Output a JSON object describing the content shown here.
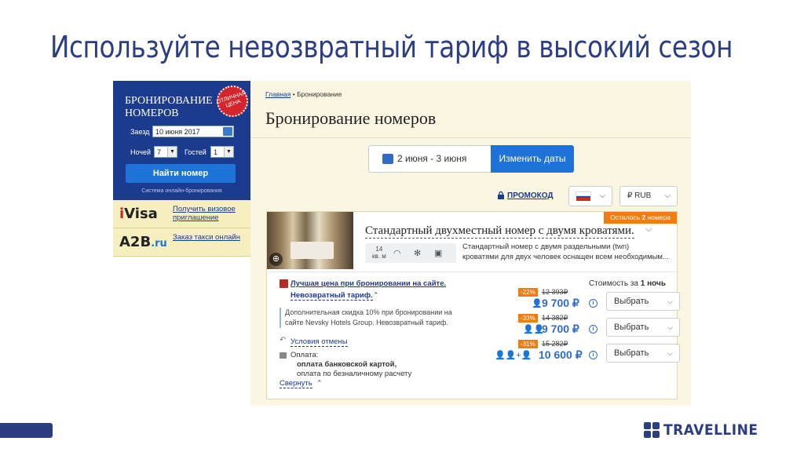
{
  "slide": {
    "title": "Используйте невозвратный тариф в высокий сезон",
    "brand": "TRAVELLINE"
  },
  "widget": {
    "title": "Бронирование номеров",
    "stamp": "ОТЛИЧНАЯ ЦЕНА",
    "checkin_label": "Заезд",
    "checkin_value": "10 июня 2017",
    "nights_label": "Ночей",
    "nights_value": "7",
    "guests_label": "Гостей",
    "guests_value": "1",
    "search_button": "Найти номер",
    "footer": "Система онлайн-бронирования"
  },
  "promos": [
    {
      "logo_a": "i",
      "logo_b": "Visa",
      "text": "Получить визовое приглашение"
    },
    {
      "logo_a": "A2B",
      "logo_b": ".ru",
      "text": "Заказ такси онлайн"
    }
  ],
  "panel": {
    "breadcrumb_home": "Главная",
    "breadcrumb_sep": "•",
    "breadcrumb_current": "Бронирование",
    "title": "Бронирование номеров",
    "dates": "2 июня - 3 июня",
    "change_dates": "Изменить даты",
    "promocode": "ПРОМОКОД",
    "currency": "₽ RUB",
    "flag_colors": [
      "#ffffff",
      "#1e4fb4",
      "#d52b1e"
    ]
  },
  "room": {
    "badge_prefix": "Осталось",
    "badge_count": "2",
    "badge_suffix": "номера",
    "title": "Стандартный двухместный номер с двумя кроватями.",
    "area": "14",
    "area_unit": "кв. м",
    "desc_line1": "Стандартный номер с двумя раздельными (twn)",
    "desc_line2": "кроватями для двух человек оснащен всем необходимым",
    "desc_more": "..."
  },
  "rate": {
    "best_price": "Лучшая цена при бронировании на сайте.",
    "name": "Невозвратный тариф.",
    "description": "Дополнительная скидка 10% при бронировании на сайте Nevsky Hotels Group. Невозвратный тариф.",
    "cancel": "Условия отмены",
    "payment_label": "Оплата:",
    "payment_1": "оплата банковской картой,",
    "payment_2": "оплата по безналичному расчету",
    "collapse": "Свернуть",
    "cost_prefix": "Стоимость за",
    "cost_nights": "1 ночь",
    "options": [
      {
        "discount": "-22%",
        "old_price": "12 393₽",
        "price": "9 700 ₽",
        "guests": "1",
        "button": "Выбрать"
      },
      {
        "discount": "-33%",
        "old_price": "14 382₽",
        "price": "9 700 ₽",
        "guests": "2",
        "button": "Выбрать"
      },
      {
        "discount": "-31%",
        "old_price": "15 282₽",
        "price": "10 600 ₽",
        "guests": "2+1",
        "button": "Выбрать"
      }
    ]
  }
}
